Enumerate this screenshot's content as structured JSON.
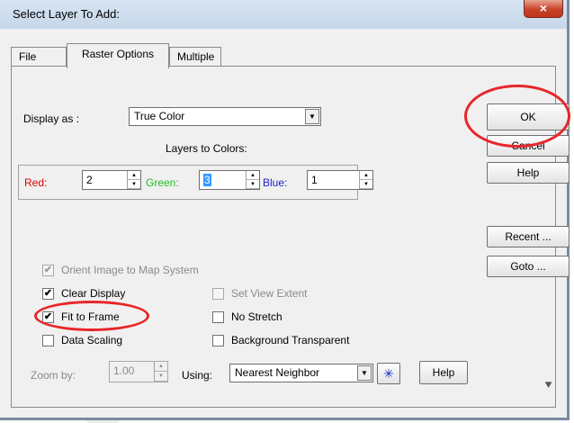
{
  "window": {
    "title": "Select Layer To Add:",
    "close_glyph": "×"
  },
  "tabs": [
    "File",
    "Raster Options",
    "Multiple"
  ],
  "display_as": {
    "label": "Display as :",
    "value": "True Color"
  },
  "layers_to_colors": {
    "title": "Layers to Colors:",
    "red": {
      "label": "Red:",
      "value": "2",
      "color": "#e00000"
    },
    "green": {
      "label": "Green:",
      "value": "3",
      "color": "#22c022"
    },
    "blue": {
      "label": "Blue:",
      "value": "1",
      "color": "#2020d0"
    }
  },
  "buttons": {
    "ok": "OK",
    "cancel": "Cancel",
    "help": "Help",
    "recent": "Recent ...",
    "goto": "Goto ...",
    "help2": "Help"
  },
  "checkboxes": {
    "orient": {
      "label": "Orient Image to Map System",
      "checked": true,
      "enabled": false
    },
    "clear_display": {
      "label": "Clear Display",
      "checked": true,
      "enabled": true
    },
    "fit_to_frame": {
      "label": "Fit to Frame",
      "checked": true,
      "enabled": true
    },
    "data_scaling": {
      "label": "Data Scaling",
      "checked": false,
      "enabled": true
    },
    "set_view_extent": {
      "label": "Set View Extent",
      "checked": false,
      "enabled": false
    },
    "no_stretch": {
      "label": "No Stretch",
      "checked": false,
      "enabled": true
    },
    "background_transparent": {
      "label": "Background Transparent",
      "checked": false,
      "enabled": true
    }
  },
  "zoom": {
    "label": "Zoom by:",
    "value": "1.00",
    "using_label": "Using:",
    "method": "Nearest Neighbor"
  },
  "icons": {
    "check": "✔",
    "down": "▼",
    "up_small": "▲",
    "down_small": "▼",
    "star": "✳",
    "corner": "⯆"
  }
}
